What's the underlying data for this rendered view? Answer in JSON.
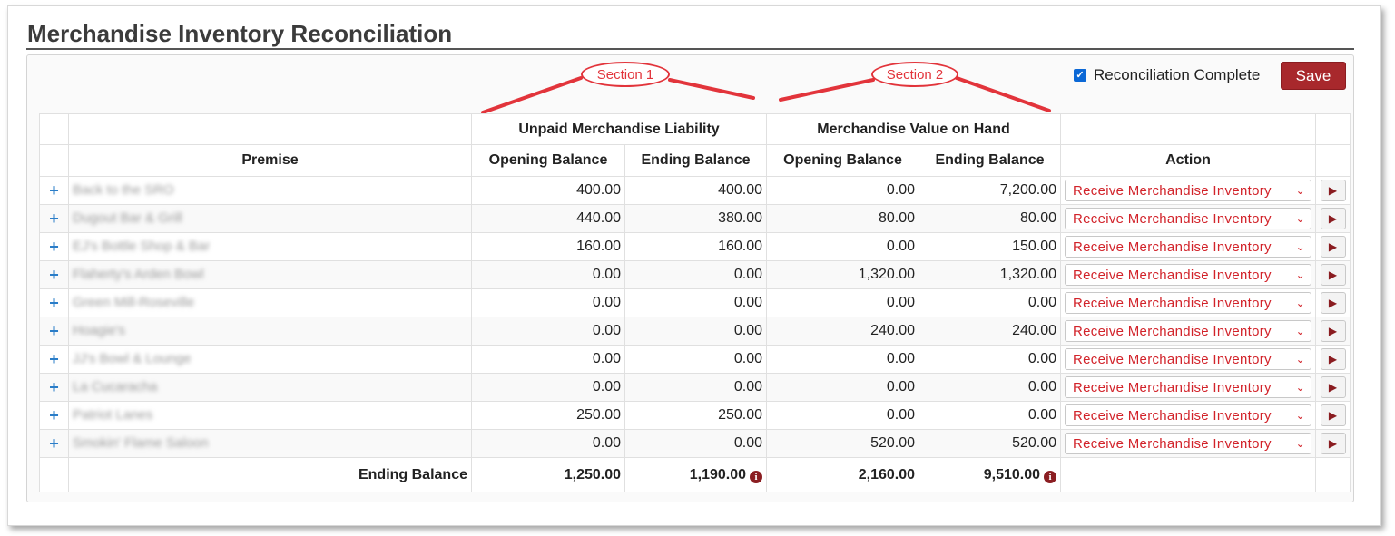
{
  "page": {
    "title": "Merchandise Inventory Reconciliation"
  },
  "toolbar": {
    "reconciliation_label": "Reconciliation Complete",
    "reconciliation_checked": true,
    "save_label": "Save"
  },
  "annotations": {
    "section1": "Section 1",
    "section2": "Section 2",
    "color": "#e2343b"
  },
  "table": {
    "group_headers": {
      "unpaid": "Unpaid Merchandise Liability",
      "value": "Merchandise Value on Hand"
    },
    "columns": {
      "premise": "Premise",
      "opening": "Opening Balance",
      "ending": "Ending Balance",
      "action": "Action"
    },
    "rows": [
      {
        "premise": "Back to the SRO",
        "ul_open": "400.00",
        "ul_end": "400.00",
        "mv_open": "0.00",
        "mv_end": "7,200.00",
        "action": "Receive Merchandise Inventory"
      },
      {
        "premise": "Dugout Bar & Grill",
        "ul_open": "440.00",
        "ul_end": "380.00",
        "mv_open": "80.00",
        "mv_end": "80.00",
        "action": "Receive Merchandise Inventory"
      },
      {
        "premise": "EJ's Bottle Shop & Bar",
        "ul_open": "160.00",
        "ul_end": "160.00",
        "mv_open": "0.00",
        "mv_end": "150.00",
        "action": "Receive Merchandise Inventory"
      },
      {
        "premise": "Flaherty's Arden Bowl",
        "ul_open": "0.00",
        "ul_end": "0.00",
        "mv_open": "1,320.00",
        "mv_end": "1,320.00",
        "action": "Receive Merchandise Inventory"
      },
      {
        "premise": "Green Mill-Roseville",
        "ul_open": "0.00",
        "ul_end": "0.00",
        "mv_open": "0.00",
        "mv_end": "0.00",
        "action": "Receive Merchandise Inventory"
      },
      {
        "premise": "Hoagie's",
        "ul_open": "0.00",
        "ul_end": "0.00",
        "mv_open": "240.00",
        "mv_end": "240.00",
        "action": "Receive Merchandise Inventory"
      },
      {
        "premise": "JJ's Bowl & Lounge",
        "ul_open": "0.00",
        "ul_end": "0.00",
        "mv_open": "0.00",
        "mv_end": "0.00",
        "action": "Receive Merchandise Inventory"
      },
      {
        "premise": "La Cucaracha",
        "ul_open": "0.00",
        "ul_end": "0.00",
        "mv_open": "0.00",
        "mv_end": "0.00",
        "action": "Receive Merchandise Inventory"
      },
      {
        "premise": "Patriot Lanes",
        "ul_open": "250.00",
        "ul_end": "250.00",
        "mv_open": "0.00",
        "mv_end": "0.00",
        "action": "Receive Merchandise Inventory"
      },
      {
        "premise": "Smokin' Flame Saloon",
        "ul_open": "0.00",
        "ul_end": "0.00",
        "mv_open": "520.00",
        "mv_end": "520.00",
        "action": "Receive Merchandise Inventory"
      }
    ],
    "footer": {
      "label": "Ending Balance",
      "ul_open": "1,250.00",
      "ul_end": "1,190.00",
      "mv_open": "2,160.00",
      "mv_end": "9,510.00"
    }
  },
  "icons": {
    "expand": "+",
    "go": "▶",
    "chevron": "⌄",
    "info": "i",
    "check": "✓"
  },
  "colors": {
    "accent_button": "#a8282c",
    "action_text": "#d2232a",
    "expand_icon": "#2a7dc8",
    "info_icon": "#8b1e22",
    "checkbox": "#0b68d6"
  }
}
